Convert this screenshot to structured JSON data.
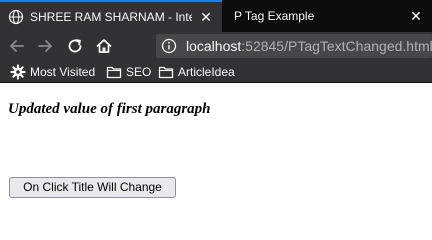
{
  "tabs": [
    {
      "title": "SHREE RAM SHARNAM - Intern",
      "active": true
    },
    {
      "title": "P Tag Example",
      "active": false
    }
  ],
  "urlbar": {
    "host": "localhost",
    "rest": ":52845/PTagTextChanged.html"
  },
  "bookmarks": [
    {
      "label": "Most Visited",
      "icon": "gear-icon"
    },
    {
      "label": "SEO",
      "icon": "folder-icon"
    },
    {
      "label": "ArticleIdea",
      "icon": "folder-icon"
    }
  ],
  "page": {
    "paragraph": "Updated value of first paragraph",
    "button_label": "On Click Title Will Change"
  },
  "colors": {
    "tabbar_bg": "#0c0c0d",
    "toolbar_bg": "#323234",
    "urlbar_bg": "#474749",
    "accent": "#0a84ff"
  }
}
